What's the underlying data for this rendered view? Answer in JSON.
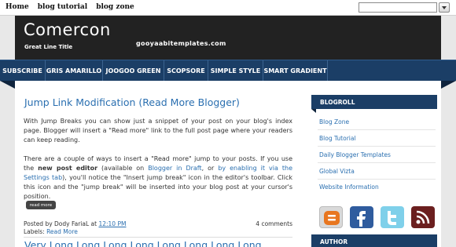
{
  "topnav": [
    "Home",
    "blog tutorial",
    "blog zone"
  ],
  "header": {
    "title": "Comercon",
    "tagline": "Great Line Title",
    "url": "gooyaabitemplates.com"
  },
  "nav": [
    "SUBSCRIBE",
    "GRIS AMARILLO",
    "JOOGOO GREEN",
    "SCOPSORE",
    "SIMPLE STYLE",
    "SMART GRADIENT"
  ],
  "post": {
    "title": "Jump Link Modification (Read More Blogger)",
    "p1": "With Jump Breaks you can show just a snippet of your post on your blog's index page. Blogger will insert a \"Read more\" link to the full post page where your readers can keep reading.",
    "p2_a": "There are a couple of ways to insert a \"Read more\" jump to your posts. If you use the ",
    "p2_b": "new post editor",
    "p2_c": " (available on ",
    "p2_d": "Blogger in Draft",
    "p2_e": ", or ",
    "p2_f": "by enabling it via the Settings tab",
    "p2_g": "), you'll notice the \"Insert jump break\" icon in the editor's toolbar. Click this icon and the \"jump break\" will be inserted into your blog post at your cursor's position.",
    "read_more": "read more",
    "posted_by": "Posted by Dody FariaL at",
    "time": "12:10 PM",
    "comments": "4 comments",
    "labels_prefix": "Labels:",
    "label": "Read More",
    "next_title": "Very Long Long Long Long Long Long Long Long"
  },
  "sidebar": {
    "blogroll_title": "BLOGROLL",
    "links": [
      "Blog Zone",
      "Blog Tutorial",
      "Daily Blogger Templates",
      "Global Vizta",
      "Website Information"
    ],
    "author_title": "AUTHOR",
    "social_icons": [
      "blogger-icon",
      "facebook-icon",
      "twitter-icon",
      "rss-icon"
    ]
  },
  "colors": {
    "accent": "#1b3e66",
    "link": "#2a6fb0",
    "header_bg": "#222222"
  }
}
